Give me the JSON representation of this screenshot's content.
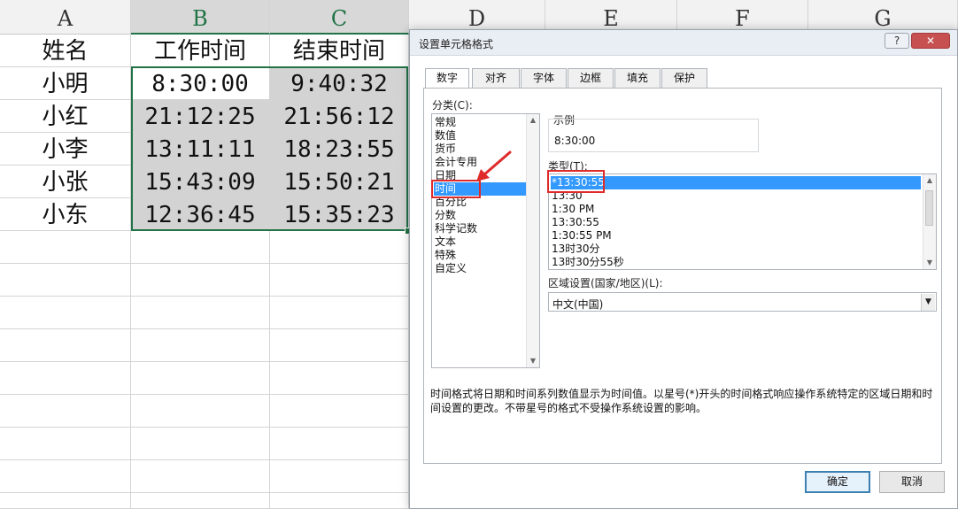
{
  "spreadsheet": {
    "column_headers": [
      "A",
      "B",
      "C",
      "D",
      "E",
      "F",
      "G"
    ],
    "rows": [
      {
        "name": "姓名",
        "start": "工作时间",
        "end": "结束时间"
      },
      {
        "name": "小明",
        "start": "8:30:00",
        "end": "9:40:32"
      },
      {
        "name": "小红",
        "start": "21:12:25",
        "end": "21:56:12"
      },
      {
        "name": "小李",
        "start": "13:11:11",
        "end": "18:23:55"
      },
      {
        "name": "小张",
        "start": "15:43:09",
        "end": "15:50:21"
      },
      {
        "name": "小东",
        "start": "12:36:45",
        "end": "15:35:23"
      }
    ]
  },
  "dialog": {
    "title": "设置单元格格式",
    "help_label": "?",
    "close_label": "✕",
    "tabs": [
      "数字",
      "对齐",
      "字体",
      "边框",
      "填充",
      "保护"
    ],
    "active_tab": "数字",
    "category_label": "分类(C):",
    "categories": [
      "常规",
      "数值",
      "货币",
      "会计专用",
      "日期",
      "时间",
      "百分比",
      "分数",
      "科学记数",
      "文本",
      "特殊",
      "自定义"
    ],
    "selected_category": "时间",
    "sample_label": "示例",
    "sample_value": "8:30:00",
    "type_label": "类型(T):",
    "types": [
      "*13:30:55",
      "13:30",
      "1:30 PM",
      "13:30:55",
      "1:30:55 PM",
      "13时30分",
      "13时30分55秒"
    ],
    "selected_type": "*13:30:55",
    "locale_label": "区域设置(国家/地区)(L):",
    "locale_value": "中文(中国)",
    "description": "时间格式将日期和时间系列数值显示为时间值。以星号(*)开头的时间格式响应操作系统特定的区域日期和时间设置的更改。不带星号的格式不受操作系统设置的影响。",
    "ok_label": "确定",
    "cancel_label": "取消"
  },
  "colors": {
    "excel_green": "#217346",
    "selection_blue": "#3399ff",
    "highlight_red": "#e02b2b",
    "cell_shade": "#d3d3d3"
  }
}
